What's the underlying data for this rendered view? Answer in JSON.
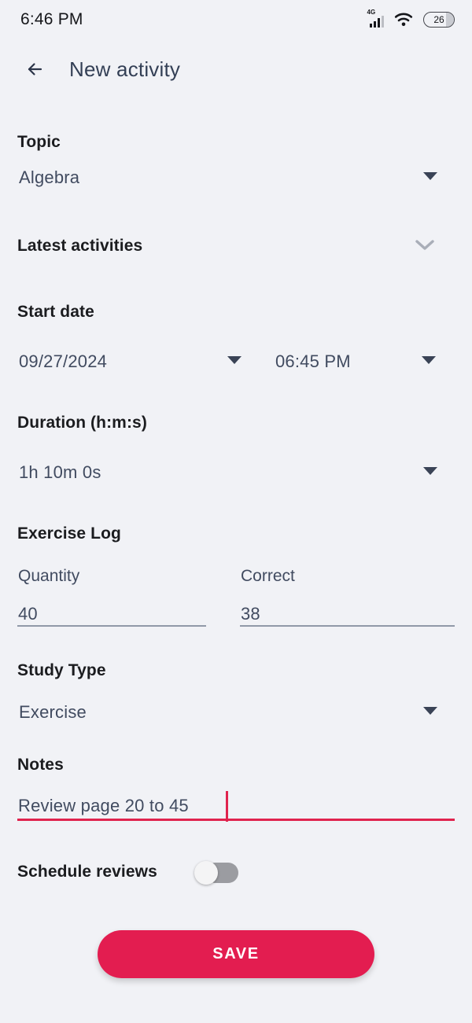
{
  "status_bar": {
    "time": "6:46 PM",
    "network_label": "4G",
    "battery_level": "26",
    "icons": [
      "signal-icon",
      "wifi-icon",
      "battery-icon"
    ]
  },
  "app_bar": {
    "back_icon": "arrow-left-icon",
    "title": "New activity"
  },
  "form": {
    "topic": {
      "label": "Topic",
      "value": "Algebra",
      "dropdown_icon": "caret-down-icon"
    },
    "latest_activities": {
      "label": "Latest activities",
      "expand_icon": "chevron-down-icon"
    },
    "start_date": {
      "label": "Start date",
      "date_value": "09/27/2024",
      "time_value": "06:45 PM",
      "date_dropdown_icon": "caret-down-icon",
      "time_dropdown_icon": "caret-down-icon"
    },
    "duration": {
      "label": "Duration (h:m:s)",
      "value": "1h 10m 0s",
      "dropdown_icon": "caret-down-icon"
    },
    "exercise_log": {
      "label": "Exercise Log",
      "quantity_label": "Quantity",
      "quantity_value": "40",
      "correct_label": "Correct",
      "correct_value": "38"
    },
    "study_type": {
      "label": "Study Type",
      "value": "Exercise",
      "dropdown_icon": "caret-down-icon"
    },
    "notes": {
      "label": "Notes",
      "value": "Review page 20 to 45",
      "focused": true
    },
    "schedule_reviews": {
      "label": "Schedule reviews",
      "enabled": false
    }
  },
  "save_button": {
    "label": "SAVE"
  },
  "colors": {
    "background": "#f1f2f6",
    "accent": "#e31d50",
    "label_text": "#1b1c1f",
    "value_text": "#414b60",
    "title_text": "#333f55",
    "caret": "#3a4356",
    "underline": "#9199a8",
    "toggle_track": "#9b9ca1"
  }
}
